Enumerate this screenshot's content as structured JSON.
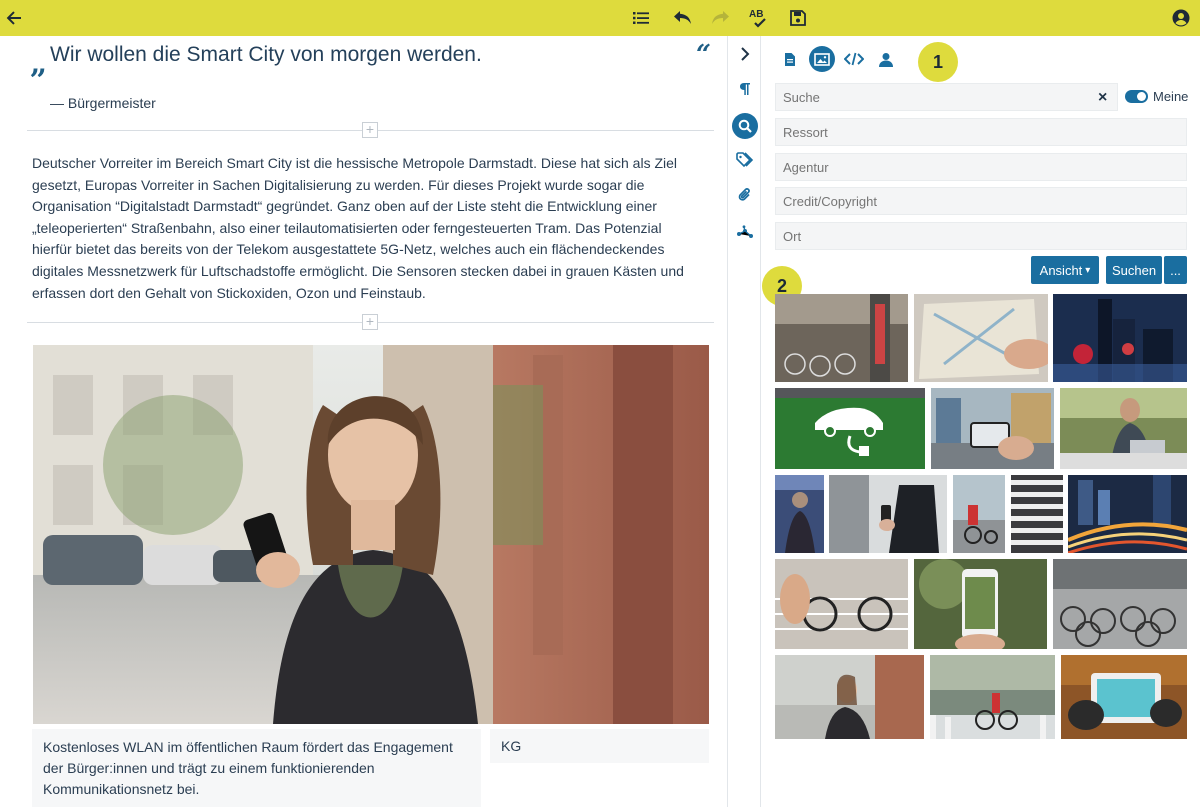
{
  "toolbar": {
    "back_icon": "arrow-left-icon",
    "list_icon": "list-icon",
    "undo_icon": "undo-icon",
    "redo_icon": "redo-icon",
    "spellcheck_icon": "spellcheck-icon",
    "spellcheck_label": "AB",
    "save_icon": "save-icon",
    "account_icon": "user-circle-icon",
    "background": "#dedb3d"
  },
  "article": {
    "quote_open": "„",
    "quote_text": "Wir wollen die Smart City von morgen werden.",
    "quote_close": "“",
    "quote_author": "— Bürgermeister",
    "body_lines": [
      "Deutscher Vorreiter im Bereich Smart City ist die hessische Metropole Darmstadt. Diese hat sich als Ziel",
      "gesetzt, Europas Vorreiter in Sachen Digitalisierung zu werden. Für dieses Projekt wurde sogar die",
      "Organisation “Digitalstadt Darmstadt“ gegründet. Ganz oben auf der Liste steht die Entwicklung einer",
      "„teleoperierten“ Straßenbahn, also einer teilautomatisierten oder ferngesteuerten Tram. Das Potenzial",
      "hierfür bietet das bereits von der Telekom ausgestattete 5G-Netz, welches auch ein flächendeckendes",
      "digitales Messnetzwerk für Luftschadstoffe ermöglicht. Die Sensoren stecken dabei in grauen Kästen und",
      "erfassen dort den Gehalt von Stickoxiden, Ozon und Feinstaub."
    ],
    "caption_lines": [
      "Kostenloses WLAN im öffentlichen Raum fördert das Engagement",
      "der Bürger:innen und trägt zu einem funktionierenden",
      "Kommunikationsnetz bei."
    ],
    "credit": "KG",
    "add_block_symbol": "+"
  },
  "toolstrip": {
    "items": [
      "chevron-right-icon",
      "paragraph-icon",
      "search-icon",
      "tags-icon",
      "paperclip-icon",
      "network-icon"
    ],
    "active": "search-icon"
  },
  "panel": {
    "tabs": [
      "document-icon",
      "image-icon",
      "code-icon",
      "person-icon"
    ],
    "active_tab": "image-icon",
    "badge_1": "1",
    "badge_2": "2",
    "search_placeholder": "Suche",
    "ressort_placeholder": "Ressort",
    "agentur_placeholder": "Agentur",
    "credit_placeholder": "Credit/Copyright",
    "ort_placeholder": "Ort",
    "clear_symbol": "×",
    "toggle_label": "Meine",
    "toggle_on": true,
    "view_button": "Ansicht",
    "view_caret": "▾",
    "search_button": "Suchen",
    "more_button": "...",
    "accent": "#1a6ea0"
  },
  "results": {
    "images": [
      "bike-rental-street",
      "hands-holding-map",
      "city-night-skyline",
      "electric-car-charging-sign",
      "hand-holding-phone-street",
      "man-with-laptop-outdoor",
      "crowd-at-night",
      "person-using-phone",
      "cyclists-on-road",
      "zebra-crossing",
      "highway-light-trails",
      "bicycle-near-steps",
      "phone-camera-photo",
      "rows-of-bicycles",
      "woman-with-phone",
      "cyclist-city-street",
      "hands-holding-tablet"
    ]
  }
}
